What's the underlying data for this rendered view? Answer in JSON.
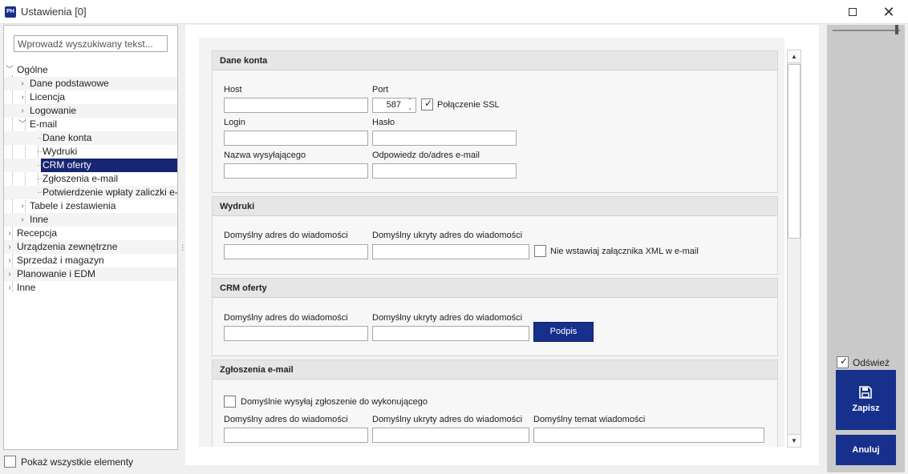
{
  "window": {
    "title": "Ustawienia [0]",
    "app_icon_text": "PH",
    "close_glyph": "✕"
  },
  "sidebar": {
    "search_placeholder": "Wprowadź wyszukiwany tekst...",
    "tree": {
      "ogolne": "Ogólne",
      "dane_podstawowe": "Dane podstawowe",
      "licencja": "Licencja",
      "logowanie": "Logowanie",
      "email": "E-mail",
      "dane_konta": "Dane konta",
      "wydruki": "Wydruki",
      "crm_oferty": "CRM oferty",
      "zgloszenia_email": "Zgłoszenia e-mail",
      "potwierdzenie": "Potwierdzenie wpłaty zaliczki e-mail",
      "tabele": "Tabele i zestawienia",
      "inne_sub": "Inne",
      "recepcja": "Recepcja",
      "urzadzenia": "Urządzenia zewnętrzne",
      "sprzedaz": "Sprzedaż i magazyn",
      "planowanie": "Planowanie i EDM",
      "inne": "Inne"
    },
    "show_all_label": "Pokaż wszystkie elementy",
    "show_all_checked": false
  },
  "sections": {
    "dane_konta": {
      "title": "Dane konta",
      "host_label": "Host",
      "host_value": "",
      "port_label": "Port",
      "port_value": "587",
      "ssl_label": "Połączenie SSL",
      "ssl_checked": true,
      "login_label": "Login",
      "login_value": "",
      "haslo_label": "Hasło",
      "haslo_value": "",
      "nazwa_label": "Nazwa wysyłającego",
      "nazwa_value": "",
      "odpowiedz_label": "Odpowiedz do/adres e-mail",
      "odpowiedz_value": ""
    },
    "wydruki": {
      "title": "Wydruki",
      "adres_label": "Domyślny adres do wiadomości",
      "ukryty_label": "Domyślny ukryty adres do wiadomości",
      "xml_label": "Nie wstawiaj załącznika XML w e-mail",
      "xml_checked": false
    },
    "crm_oferty": {
      "title": "CRM oferty",
      "adres_label": "Domyślny adres do wiadomości",
      "ukryty_label": "Domyślny ukryty adres do wiadomości",
      "podpis_button": "Podpis"
    },
    "zgloszenia": {
      "title": "Zgłoszenia e-mail",
      "wysylaj_label": "Domyślnie wysyłaj zgłoszenie do wykonującego",
      "wysylaj_checked": false,
      "adres_label": "Domyślny adres do wiadomości",
      "ukryty_label": "Domyślny ukryty adres do wiadomości",
      "temat_label": "Domyślny temat wiadomości"
    }
  },
  "right_panel": {
    "refresh_label": "Odśwież",
    "refresh_checked": true,
    "save_label": "Zapisz",
    "cancel_label": "Anuluj"
  },
  "colors": {
    "accent": "#16308c",
    "selection": "#172672"
  }
}
